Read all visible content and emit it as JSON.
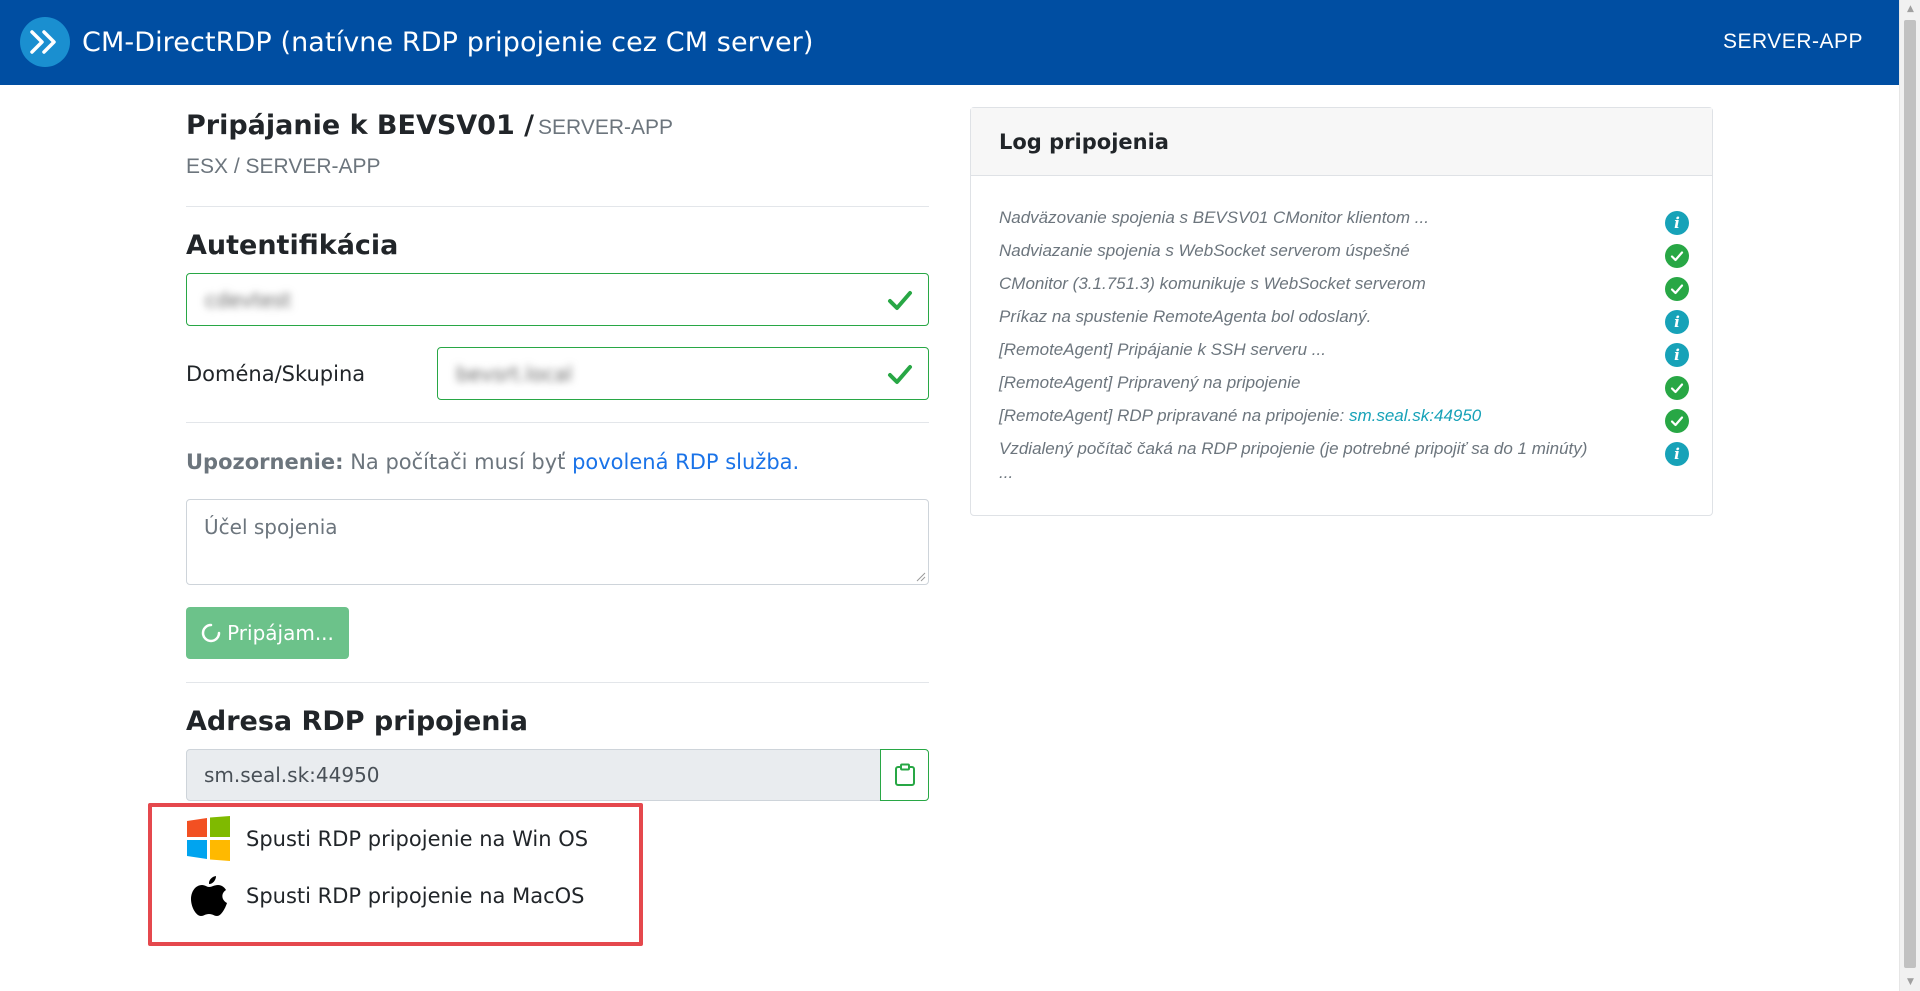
{
  "header": {
    "title": "CM-DirectRDP (natívne RDP pripojenie cez CM server)",
    "server": "SERVER-APP",
    "logo_icon": "double-chevron-right-icon"
  },
  "connection": {
    "title": "Pripájanie k BEVSV01 /",
    "title_server": "SERVER-APP",
    "path": "ESX / SERVER-APP"
  },
  "auth": {
    "heading": "Autentifikácia",
    "username_value": "cdevtest",
    "domain_label": "Doména/Skupina",
    "domain_value": "bevsrt.local"
  },
  "warning": {
    "bold": "Upozornenie:",
    "text": "Na počítači musí byť",
    "link": "povolená RDP služba."
  },
  "purpose": {
    "placeholder": "Účel spojenia"
  },
  "connect_button": {
    "label": "Pripájam..."
  },
  "rdp_address": {
    "heading": "Adresa RDP pripojenia",
    "value": "sm.seal.sk:44950"
  },
  "launch": {
    "win_label": "Spusti RDP pripojenie na Win OS",
    "mac_label": "Spusti RDP pripojenie na MacOS"
  },
  "log": {
    "title": "Log pripojenia",
    "entries": [
      {
        "text": "Nadväzovanie spojenia s BEVSV01 CMonitor klientom ...",
        "status": "info"
      },
      {
        "text": "Nadviazanie spojenia s WebSocket serverom úspešné",
        "status": "ok"
      },
      {
        "text": "CMonitor (3.1.751.3) komunikuje s WebSocket serverom",
        "status": "ok"
      },
      {
        "text": "Príkaz na spustenie RemoteAgenta bol odoslaný.",
        "status": "info"
      },
      {
        "text": "[RemoteAgent] Pripájanie k SSH serveru ...",
        "status": "info"
      },
      {
        "text": "[RemoteAgent] Pripravený na pripojenie",
        "status": "ok"
      },
      {
        "text": "[RemoteAgent] RDP pripravané na pripojenie:",
        "link": "sm.seal.sk:44950",
        "status": "ok"
      },
      {
        "text": "Vzdialený počítač čaká na RDP pripojenie (je potrebné pripojiť sa do 1 minúty)",
        "text2": "...",
        "status": "info"
      }
    ]
  },
  "colors": {
    "header_bg": "#004ea2",
    "success": "#28a745",
    "info": "#17a2b8",
    "highlight": "#e5484d",
    "link": "#1a73e8"
  }
}
